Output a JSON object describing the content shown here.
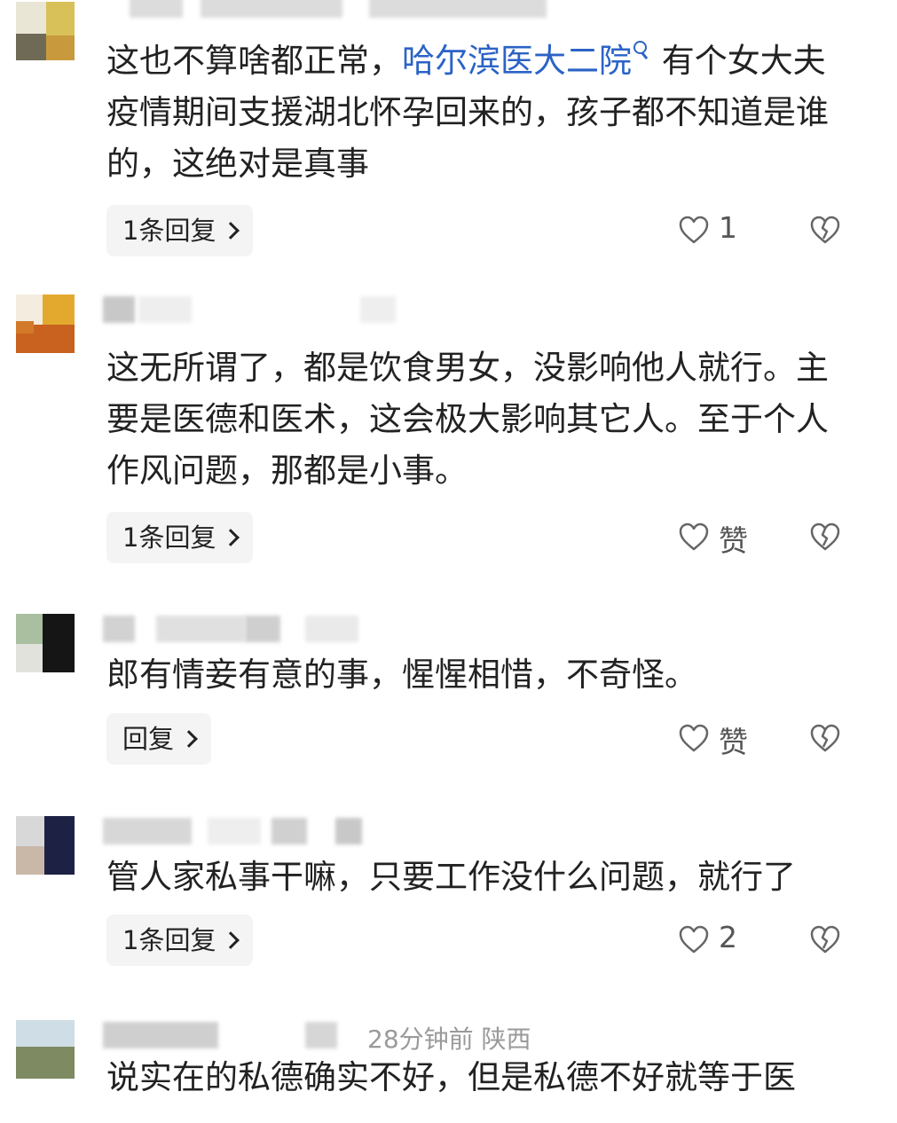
{
  "comments": [
    {
      "text_before": "这也不算啥都正常，",
      "link": "哈尔滨医大二院",
      "text_after": " 有个女大夫疫情期间支援湖北怀孕回来的，孩子都不知道是谁的，这绝对是真事",
      "reply_label": "1条回复",
      "like_label": "1"
    },
    {
      "text": "这无所谓了，都是饮食男女，没影响他人就行。主要是医德和医术，这会极大影响其它人。至于个人作风问题，那都是小事。",
      "reply_label": "1条回复",
      "like_label": "赞"
    },
    {
      "text": "郎有情妾有意的事，惺惺相惜，不奇怪。",
      "reply_label": "回复",
      "like_label": "赞"
    },
    {
      "text": "管人家私事干嘛，只要工作没什么问题，就行了",
      "reply_label": "1条回复",
      "like_label": "2"
    },
    {
      "meta_time": "28分钟前  陕西",
      "text": "说实在的私德确实不好，但是私德不好就等于医"
    }
  ],
  "icons": {
    "like": "heart-outline-icon",
    "dislike": "broken-heart-icon",
    "search": "search-icon"
  },
  "colors": {
    "link": "#2b63c6",
    "text": "#222222",
    "meta": "#9a9a9a",
    "reply_bg": "#f4f4f4"
  }
}
